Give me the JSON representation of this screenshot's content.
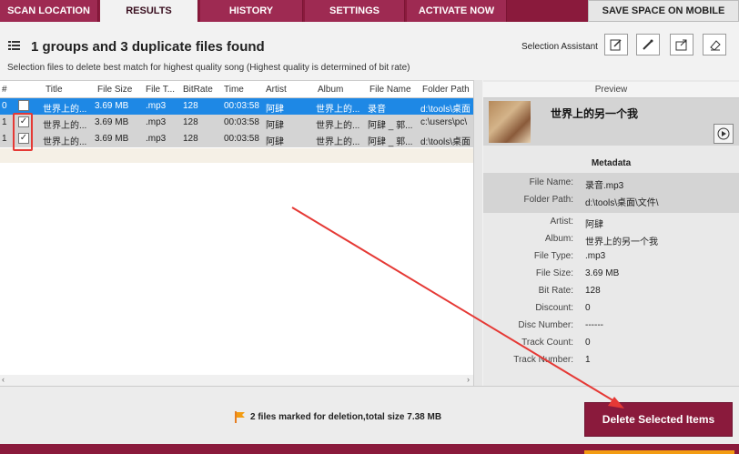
{
  "tabs": [
    {
      "label": "SCAN LOCATION"
    },
    {
      "label": "RESULTS"
    },
    {
      "label": "HISTORY"
    },
    {
      "label": "SETTINGS"
    },
    {
      "label": "ACTIVATE NOW"
    },
    {
      "label": "SAVE SPACE ON MOBILE"
    }
  ],
  "header": {
    "title": "1 groups and 3 duplicate files found",
    "subtitle": "Selection files to delete best match for highest quality song (Highest quality is determined of bit rate)",
    "selection_assistant": "Selection Assistant"
  },
  "table": {
    "columns": [
      "#",
      "Title",
      "File Size",
      "File T...",
      "BitRate",
      "Time",
      "Artist",
      "Album",
      "File Name",
      "Folder Path"
    ],
    "rows": [
      {
        "num": "0",
        "checked": false,
        "title": "世界上的...",
        "size": "3.69 MB",
        "type": ".mp3",
        "bitrate": "128",
        "time": "00:03:58",
        "artist": "阿肆",
        "album": "世界上的...",
        "filename": "录音",
        "folder": "d:\\tools\\桌面"
      },
      {
        "num": "1",
        "checked": true,
        "title": "世界上的...",
        "size": "3.69 MB",
        "type": ".mp3",
        "bitrate": "128",
        "time": "00:03:58",
        "artist": "阿肆",
        "album": "世界上的...",
        "filename": "阿肆 _ 郭...",
        "folder": "c:\\users\\pc\\"
      },
      {
        "num": "1",
        "checked": true,
        "title": "世界上的...",
        "size": "3.69 MB",
        "type": ".mp3",
        "bitrate": "128",
        "time": "00:03:58",
        "artist": "阿肆",
        "album": "世界上的...",
        "filename": "阿肆 _ 郭...",
        "folder": "d:\\tools\\桌面"
      }
    ]
  },
  "preview": {
    "header": "Preview",
    "song_title": "世界上的另一个我",
    "metadata_header": "Metadata",
    "fields": [
      {
        "label": "File Name:",
        "value": "录音.mp3"
      },
      {
        "label": "Folder Path:",
        "value": "d:\\tools\\桌面\\文件\\"
      },
      {
        "label": "Artist:",
        "value": "阿肆"
      },
      {
        "label": "Album:",
        "value": "世界上的另一个我"
      },
      {
        "label": "File Type:",
        "value": ".mp3"
      },
      {
        "label": "File Size:",
        "value": "3.69 MB"
      },
      {
        "label": "Bit Rate:",
        "value": "128"
      },
      {
        "label": "Discount:",
        "value": "0"
      },
      {
        "label": "Disc Number:",
        "value": "------"
      },
      {
        "label": "Track Count:",
        "value": "0"
      },
      {
        "label": "Track Number:",
        "value": "1"
      }
    ]
  },
  "status": {
    "text": "2 files marked for deletion,total size 7.38 MB"
  },
  "delete_button": "Delete Selected Items",
  "colors": {
    "brand": "#8a1a3c",
    "selected_row": "#1e88e5",
    "annotation": "#e53935"
  }
}
